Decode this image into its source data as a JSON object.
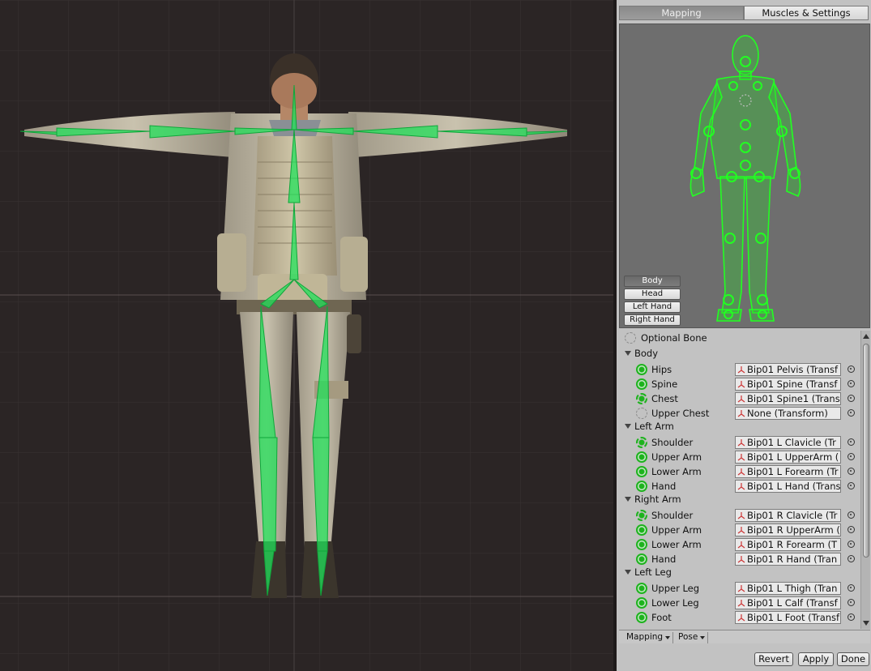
{
  "tabs": {
    "mapping": "Mapping",
    "muscles": "Muscles & Settings"
  },
  "view_buttons": {
    "body": "Body",
    "head": "Head",
    "left_hand": "Left Hand",
    "right_hand": "Right Hand"
  },
  "legend": {
    "optional_bone": "Optional Bone"
  },
  "sections": {
    "body": "Body",
    "left_arm": "Left Arm",
    "right_arm": "Right Arm",
    "left_leg": "Left Leg"
  },
  "bones": {
    "hips": {
      "label": "Hips",
      "value": "Bip01 Pelvis (Transf"
    },
    "spine": {
      "label": "Spine",
      "value": "Bip01 Spine (Transf"
    },
    "chest": {
      "label": "Chest",
      "value": "Bip01 Spine1 (Trans"
    },
    "upper_chest": {
      "label": "Upper Chest",
      "value": "None (Transform)"
    },
    "l_shoulder": {
      "label": "Shoulder",
      "value": "Bip01 L Clavicle (Tr"
    },
    "l_upper_arm": {
      "label": "Upper Arm",
      "value": "Bip01 L UpperArm ("
    },
    "l_lower_arm": {
      "label": "Lower Arm",
      "value": "Bip01 L Forearm (Tr"
    },
    "l_hand": {
      "label": "Hand",
      "value": "Bip01 L Hand (Trans"
    },
    "r_shoulder": {
      "label": "Shoulder",
      "value": "Bip01 R Clavicle (Tr"
    },
    "r_upper_arm": {
      "label": "Upper Arm",
      "value": "Bip01 R UpperArm ("
    },
    "r_lower_arm": {
      "label": "Lower Arm",
      "value": "Bip01 R Forearm (T"
    },
    "r_hand": {
      "label": "Hand",
      "value": "Bip01 R Hand (Tran"
    },
    "l_upper_leg": {
      "label": "Upper Leg",
      "value": "Bip01 L Thigh (Tran"
    },
    "l_lower_leg": {
      "label": "Lower Leg",
      "value": "Bip01 L Calf (Transf"
    },
    "l_foot": {
      "label": "Foot",
      "value": "Bip01 L Foot (Transf"
    }
  },
  "bottom_menu": {
    "mapping": "Mapping",
    "pose": "Pose"
  },
  "actions": {
    "revert": "Revert",
    "apply": "Apply",
    "done": "Done"
  },
  "colors": {
    "bone_green": "#1db31d",
    "skeleton_green": "#22e05a",
    "viewport_bg": "#2b2525",
    "panel_bg": "#c2c2c2"
  }
}
